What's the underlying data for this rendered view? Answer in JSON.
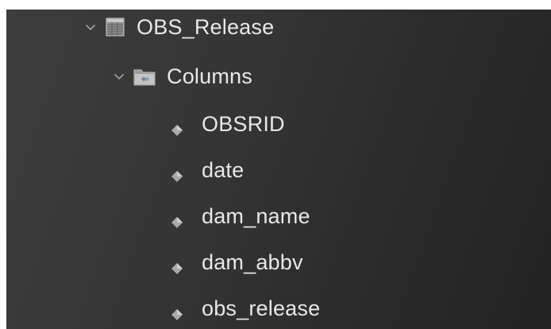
{
  "tree": {
    "table": {
      "label": "OBS_Release",
      "icon": "table-icon",
      "expanded": true
    },
    "columns_folder": {
      "label": "Columns",
      "icon": "folder-icon",
      "expanded": true
    },
    "columns": [
      {
        "label": "OBSRID",
        "icon": "column-diamond-icon"
      },
      {
        "label": "date",
        "icon": "column-diamond-icon"
      },
      {
        "label": "dam_name",
        "icon": "column-diamond-icon"
      },
      {
        "label": "dam_abbv",
        "icon": "column-diamond-icon"
      },
      {
        "label": "obs_release",
        "icon": "column-diamond-icon"
      }
    ]
  },
  "colors": {
    "background": "#363636",
    "text": "#e8e8e8",
    "icon_gray": "#b8b8b8"
  }
}
